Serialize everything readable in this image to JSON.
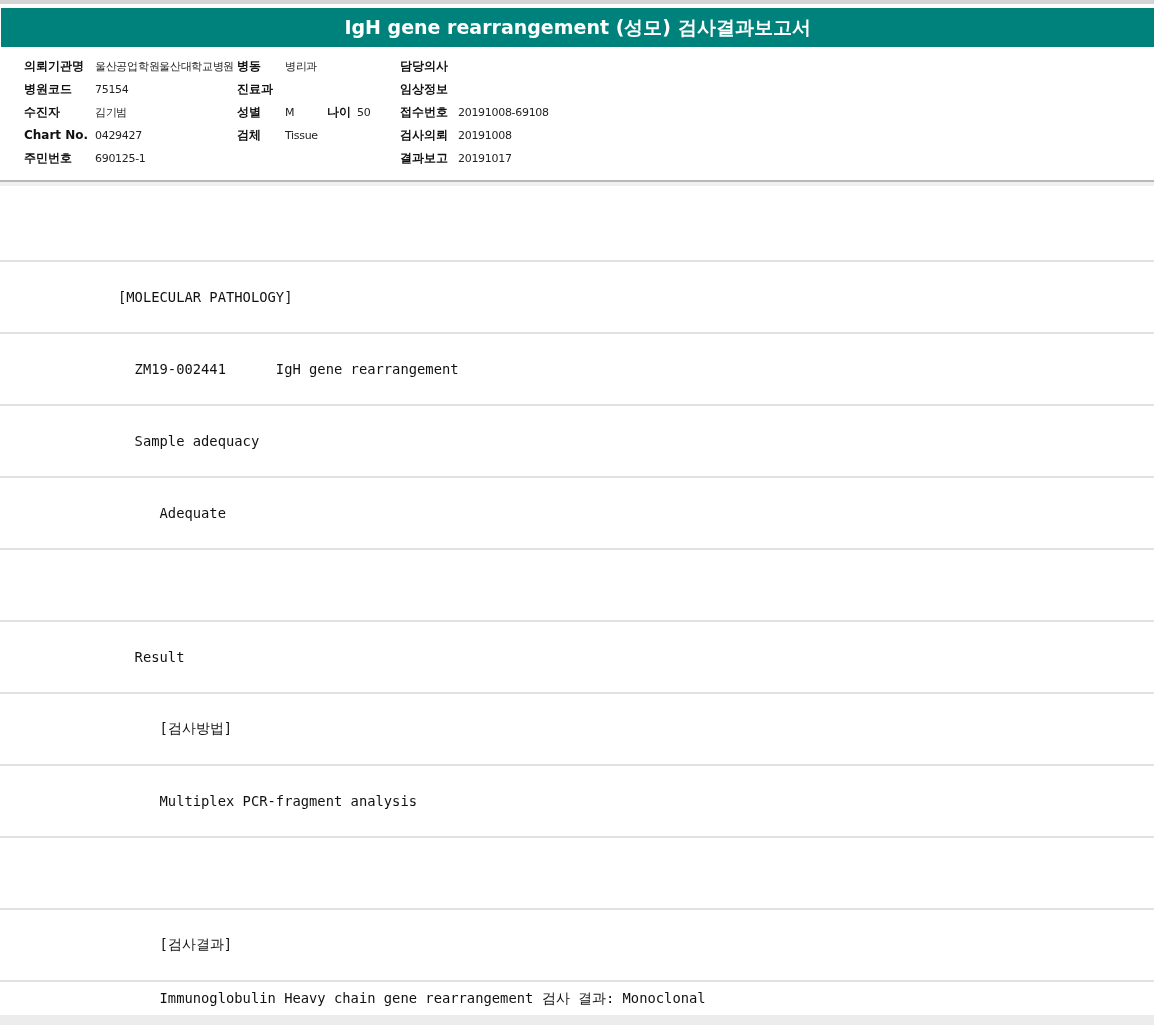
{
  "title": "IgH gene rearrangement (성모) 검사결과보고서",
  "header_rows": [
    [
      {
        "label": "의뢰기관명",
        "value": "울산공업학원울산대학교병원"
      },
      {
        "label": "병동",
        "value": "병리과"
      },
      {
        "label": "담당의사"
      }
    ],
    [
      {
        "label": "병원코드",
        "value": "75154"
      },
      {
        "label": "진료과"
      },
      {
        "label": "임상정보"
      }
    ],
    [
      {
        "label": "수진자",
        "value": "김기범"
      },
      {
        "label": "성별",
        "value": "M",
        "extra": {
          "label": "나이",
          "value": "50"
        }
      },
      {
        "label": "접수번호",
        "value": "20191008-69108"
      }
    ],
    [
      {
        "label": "Chart No.",
        "value": "0429427"
      },
      {
        "label": "검체",
        "value": "Tissue"
      },
      {
        "label": "검사의뢰",
        "value": "20191008"
      }
    ],
    [
      {
        "label": "주민번호",
        "value": "690125-1"
      },
      {},
      {
        "label": "결과보고",
        "value": "20191017"
      }
    ]
  ],
  "report_lines": [
    {
      "kind": "blank"
    },
    {
      "kind": "text",
      "text": "[MOLECULAR PATHOLOGY]"
    },
    {
      "kind": "text",
      "text": "  ZM19-002441      IgH gene rearrangement"
    },
    {
      "kind": "text",
      "text": "  Sample adequacy"
    },
    {
      "kind": "text",
      "text": "     Adequate"
    },
    {
      "kind": "blank"
    },
    {
      "kind": "text",
      "text": "  Result"
    },
    {
      "kind": "text",
      "text": "     [검사방법]"
    },
    {
      "kind": "text",
      "text": "     Multiplex PCR-fragment analysis"
    },
    {
      "kind": "blank"
    },
    {
      "kind": "text",
      "text": "     [검사결과]"
    },
    {
      "kind": "text",
      "text": "     Immunoglobulin Heavy chain gene rearrangement 검사 결과: Monoclonal"
    }
  ]
}
